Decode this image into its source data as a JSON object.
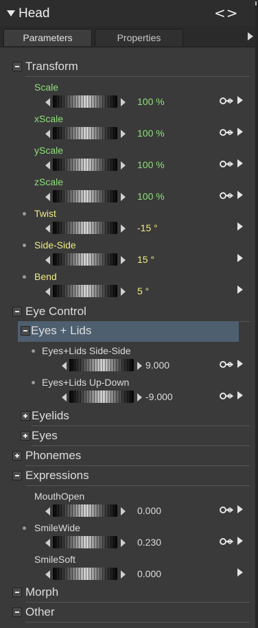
{
  "header": {
    "title": "Head",
    "nav": "<>"
  },
  "tabs": [
    "Parameters",
    "Properties"
  ],
  "groups": {
    "transform": "Transform",
    "eye_control": "Eye Control",
    "eyes_lids": "Eyes + Lids",
    "eyelids": "Eyelids",
    "eyes": "Eyes",
    "phonemes": "Phonemes",
    "expressions": "Expressions",
    "morph": "Morph",
    "other": "Other"
  },
  "params": {
    "scale": {
      "label": "Scale",
      "value": "100 %"
    },
    "xscale": {
      "label": "xScale",
      "value": "100 %"
    },
    "yscale": {
      "label": "yScale",
      "value": "100 %"
    },
    "zscale": {
      "label": "zScale",
      "value": "100 %"
    },
    "twist": {
      "label": "Twist",
      "value": "-15 °"
    },
    "side_side": {
      "label": "Side-Side",
      "value": "15 °"
    },
    "bend": {
      "label": "Bend",
      "value": "5 °"
    },
    "eyes_lids_side": {
      "label": "Eyes+Lids Side-Side",
      "value": "9.000"
    },
    "eyes_lids_updown": {
      "label": "Eyes+Lids Up-Down",
      "value": "-9.000"
    },
    "mouth_open": {
      "label": "MouthOpen",
      "value": "0.000"
    },
    "smile_wide": {
      "label": "SmileWide",
      "value": "0.230"
    },
    "smile_soft": {
      "label": "SmileSoft",
      "value": "0.000"
    }
  }
}
